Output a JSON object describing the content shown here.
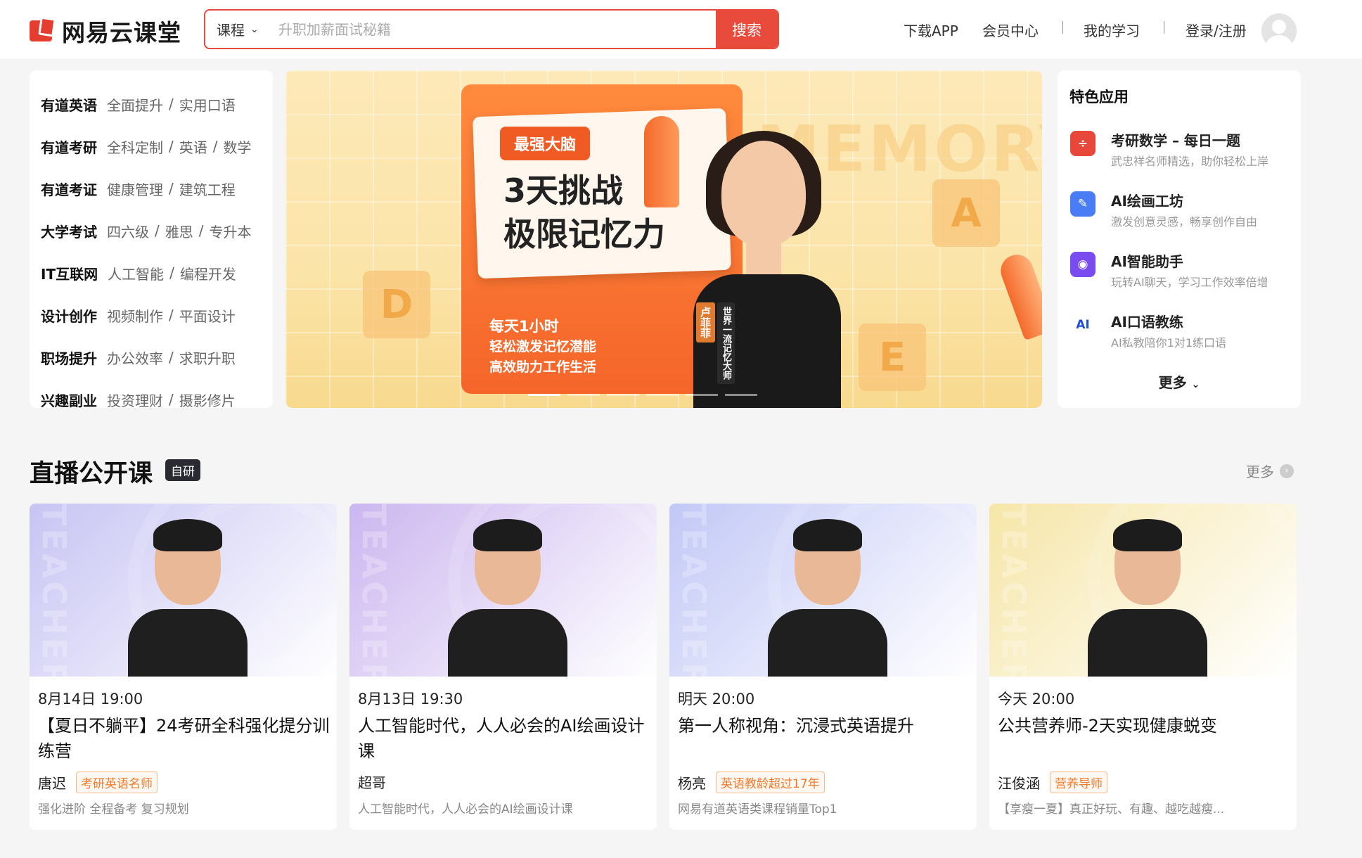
{
  "header": {
    "logo_text": "网易云课堂",
    "search": {
      "category": "课程",
      "placeholder": "升职加薪面试秘籍",
      "button": "搜索"
    },
    "nav": [
      "下载APP",
      "会员中心",
      "我的学习",
      "登录/注册"
    ]
  },
  "categories": [
    {
      "main": "有道英语",
      "subs": [
        "全面提升",
        "实用口语"
      ]
    },
    {
      "main": "有道考研",
      "subs": [
        "全科定制",
        "英语",
        "数学"
      ]
    },
    {
      "main": "有道考证",
      "subs": [
        "健康管理",
        "建筑工程"
      ]
    },
    {
      "main": "大学考试",
      "subs": [
        "四六级",
        "雅思",
        "专升本"
      ]
    },
    {
      "main": "IT互联网",
      "subs": [
        "人工智能",
        "编程开发"
      ]
    },
    {
      "main": "设计创作",
      "subs": [
        "视频制作",
        "平面设计"
      ]
    },
    {
      "main": "职场提升",
      "subs": [
        "办公效率",
        "求职升职"
      ]
    },
    {
      "main": "兴趣副业",
      "subs": [
        "投资理财",
        "摄影修片"
      ]
    }
  ],
  "banner": {
    "tag": "最强大脑",
    "title_line1": "3天挑战",
    "title_line2": "极限记忆力",
    "sub_lead": "每天1小时",
    "sub_line1": "轻松激发记忆潜能",
    "sub_line2": "高效助力工作生活",
    "watermark": "MEMORY",
    "letters": [
      "D",
      "A",
      "E"
    ],
    "name_tag": "卢菲菲",
    "title_tag": "世界一流记忆大师",
    "slide_count": 6,
    "active_slide": 0
  },
  "apps": {
    "title": "特色应用",
    "items": [
      {
        "name": "考研数学 – 每日一题",
        "desc": "武忠祥名师精选，助你轻松上岸",
        "icon": "calculator-icon",
        "color": "#e8473b",
        "glyph": "÷"
      },
      {
        "name": "AI绘画工坊",
        "desc": "激发创意灵感，畅享创作自由",
        "icon": "palette-icon",
        "color": "#4a7cf6",
        "glyph": "✎"
      },
      {
        "name": "AI智能助手",
        "desc": "玩转AI聊天，学习工作效率倍增",
        "icon": "robot-icon",
        "color": "#7a4cf0",
        "glyph": "◉"
      },
      {
        "name": "AI口语教练",
        "desc": "AI私教陪你1对1练口语",
        "icon": "ai-mentor-icon",
        "color": "#ffffff",
        "glyph": "AI"
      }
    ],
    "more": "更多"
  },
  "section": {
    "title": "直播公开课",
    "badge": "自研",
    "more": "更多"
  },
  "cards": [
    {
      "time": "8月14日 19:00",
      "title": "【夏日不躺平】24考研全科强化提分训练营",
      "teacher": "唐迟",
      "tag": "考研英语名师",
      "desc": "强化进阶 全程备考 复习规划",
      "bg": "#c7c4f3"
    },
    {
      "time": "8月13日 19:30",
      "title": "人工智能时代，人人必会的AI绘画设计课",
      "teacher": "超哥",
      "tag": "",
      "desc": "人工智能时代，人人必会的AI绘画设计课",
      "bg": "#cbb6ef"
    },
    {
      "time": "明天 20:00",
      "title": "第一人称视角：沉浸式英语提升",
      "teacher": "杨亮",
      "tag": "英语教龄超过17年",
      "desc": "网易有道英语类课程销量Top1",
      "bg": "#c2c8f6"
    },
    {
      "time": "今天 20:00",
      "title": "公共营养师-2天实现健康蜕变",
      "teacher": "汪俊涵",
      "tag": "营养导师",
      "desc": "【享瘦一夏】真正好玩、有趣、越吃越瘦...",
      "bg": "#f6e6a8"
    }
  ]
}
